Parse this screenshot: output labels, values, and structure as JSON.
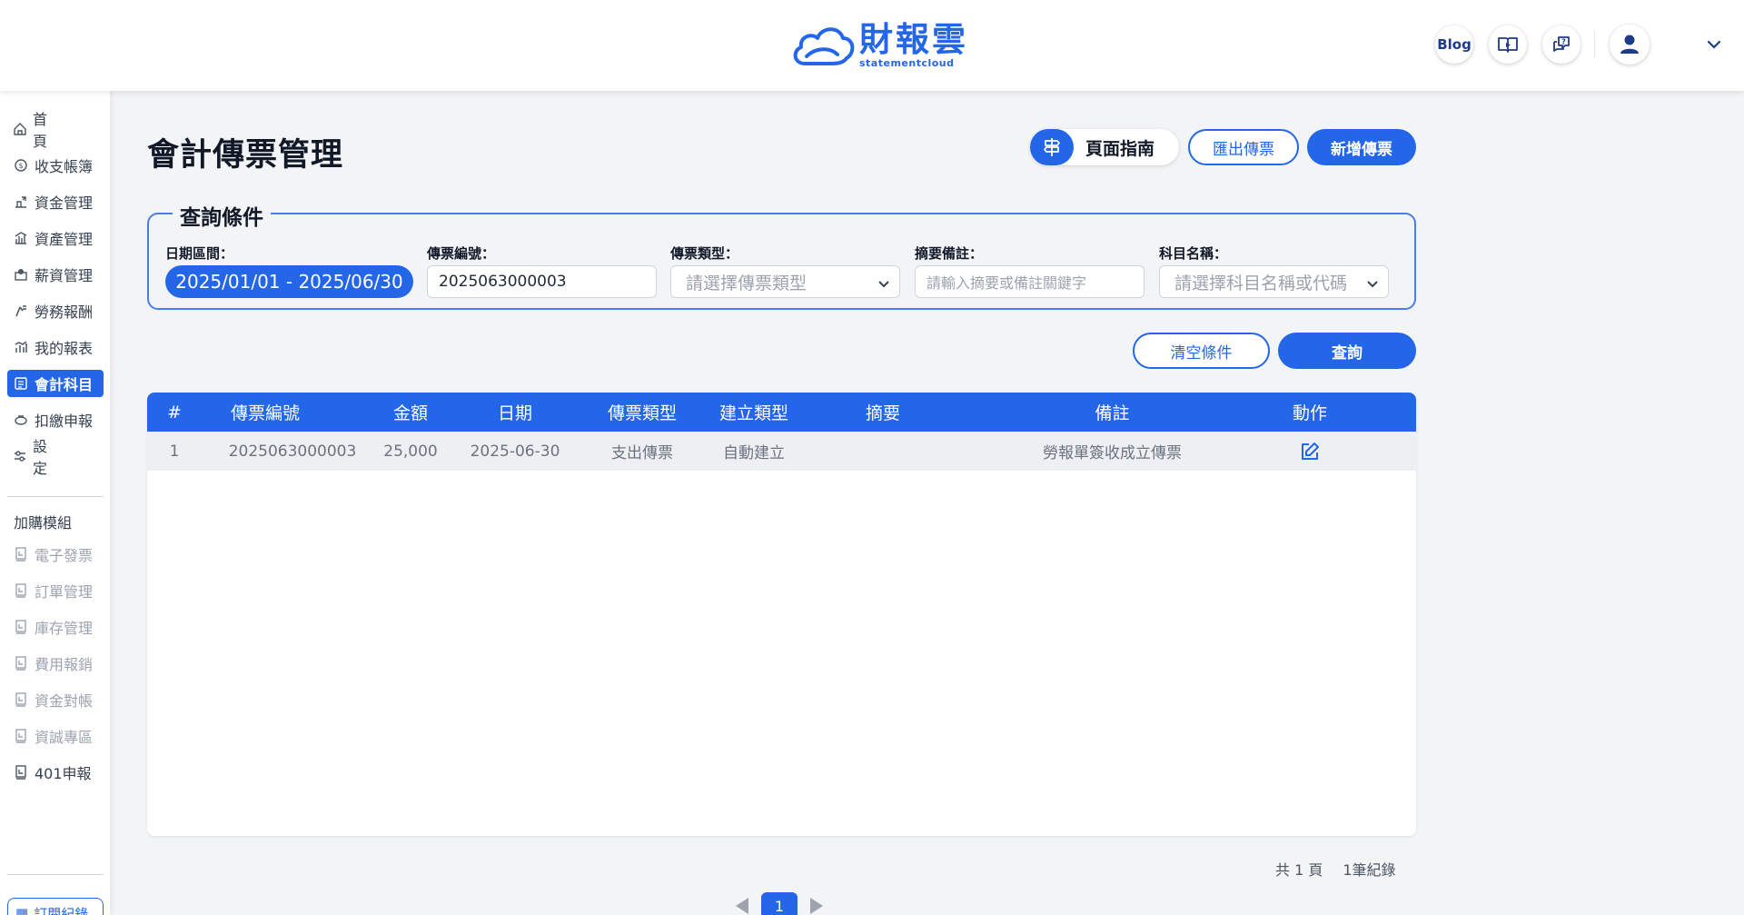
{
  "header": {
    "brand_name": "財報雲",
    "brand_sub": "statementcloud",
    "blog_label": "Blog",
    "icons": [
      "guide-book-icon",
      "help-bubble-icon",
      "user-avatar-icon",
      "chevron-down-icon"
    ]
  },
  "sidebar": {
    "items": [
      {
        "label": "首　頁",
        "icon": "home-icon"
      },
      {
        "label": "收支帳簿",
        "icon": "money-icon"
      },
      {
        "label": "資金管理",
        "icon": "fund-icon"
      },
      {
        "label": "資產管理",
        "icon": "asset-icon"
      },
      {
        "label": "薪資管理",
        "icon": "payroll-icon"
      },
      {
        "label": "勞務報酬",
        "icon": "labor-icon"
      },
      {
        "label": "我的報表",
        "icon": "report-icon"
      },
      {
        "label": "會計科目",
        "icon": "ledger-icon"
      },
      {
        "label": "扣繳申報",
        "icon": "tax-icon"
      },
      {
        "label": "設　定",
        "icon": "settings-icon"
      }
    ],
    "addon_heading": "加購模組",
    "addons": [
      {
        "label": "電子發票"
      },
      {
        "label": "訂單管理"
      },
      {
        "label": "庫存管理"
      },
      {
        "label": "費用報銷"
      },
      {
        "label": "資金對帳"
      },
      {
        "label": "資誠專區"
      },
      {
        "label": "401申報"
      }
    ],
    "subscription_label": "訂閱紀錄"
  },
  "main": {
    "title": "會計傳票管理",
    "guide_button": "頁面指南",
    "export_button": "匯出傳票",
    "add_button": "新增傳票",
    "clear_button": "清空條件",
    "search_button": "查詢"
  },
  "filters": {
    "legend": "查詢條件",
    "date_label": "日期區間：",
    "date_value": "2025/01/01 - 2025/06/30",
    "voucher_no_label": "傳票編號：",
    "voucher_no_value": "2025063000003",
    "type_label": "傳票類型：",
    "type_placeholder": "請選擇傳票類型",
    "memo_label": "摘要備註：",
    "memo_placeholder": "請輸入摘要或備註關鍵字",
    "account_label": "科目名稱：",
    "account_placeholder": "請選擇科目名稱或代碼"
  },
  "table": {
    "columns": [
      "#",
      "傳票編號",
      "金額",
      "日期",
      "傳票類型",
      "建立類型",
      "摘要",
      "備註",
      "動作"
    ],
    "rows": [
      {
        "index": "1",
        "voucher_no": "2025063000003",
        "amount": "25,000",
        "date": "2025-06-30",
        "type": "支出傳票",
        "created_by": "自動建立",
        "summary": "",
        "note": "勞報單簽收成立傳票"
      }
    ]
  },
  "pagination": {
    "total_pages_text": "共 1 頁",
    "total_records_text": "1筆紀錄",
    "current_page": "1"
  },
  "colors": {
    "accent": "#2466e8",
    "background": "#f3f4f6"
  }
}
